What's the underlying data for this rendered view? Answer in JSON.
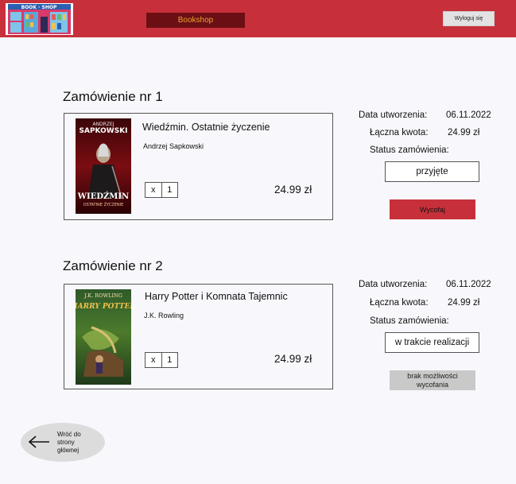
{
  "header": {
    "logo_text": "BOOK · SHOP",
    "brand_label": "Bookshop",
    "logout_label": "Wyloguj się",
    "accent_color": "#c7303a"
  },
  "orders": [
    {
      "title": "Zamówienie nr 1",
      "book_title": "Wiedźmin. Ostatnie życzenie",
      "author": "Andrzej Sapkowski",
      "cover": {
        "top_text_1": "ANDRZEJ",
        "top_text_2": "SAPKOWSKI",
        "bottom_text_1": "WIEDŹMIN",
        "bottom_text_2": "OSTATNIE ŻYCZENIE"
      },
      "qty_prefix": "x",
      "qty": "1",
      "price": "24.99 zł",
      "created_label": "Data utworzenia:",
      "created_value": "06.11.2022",
      "total_label": "Łączna kwota:",
      "total_value": "24.99 zł",
      "status_label": "Status zamówienia:",
      "status_value": "przyjęte",
      "action_label": "Wycofaj"
    },
    {
      "title": "Zamówienie nr 2",
      "book_title": "Harry Potter i Komnata Tajemnic",
      "author": "J.K. Rowling",
      "cover": {
        "top_text_1": "J.K. ROWLING",
        "bottom_text_1": "HARRY POTTER"
      },
      "qty_prefix": "x",
      "qty": "1",
      "price": "24.99 zł",
      "created_label": "Data utworzenia:",
      "created_value": "06.11.2022",
      "total_label": "Łączna kwota:",
      "total_value": "24.99 zł",
      "status_label": "Status zamówienia:",
      "status_value": "w trakcie realizacji",
      "action_label": "brak możliwości wycofania"
    }
  ],
  "back": {
    "label": "Wróć do strony głównej",
    "icon": "arrow-left-icon"
  }
}
